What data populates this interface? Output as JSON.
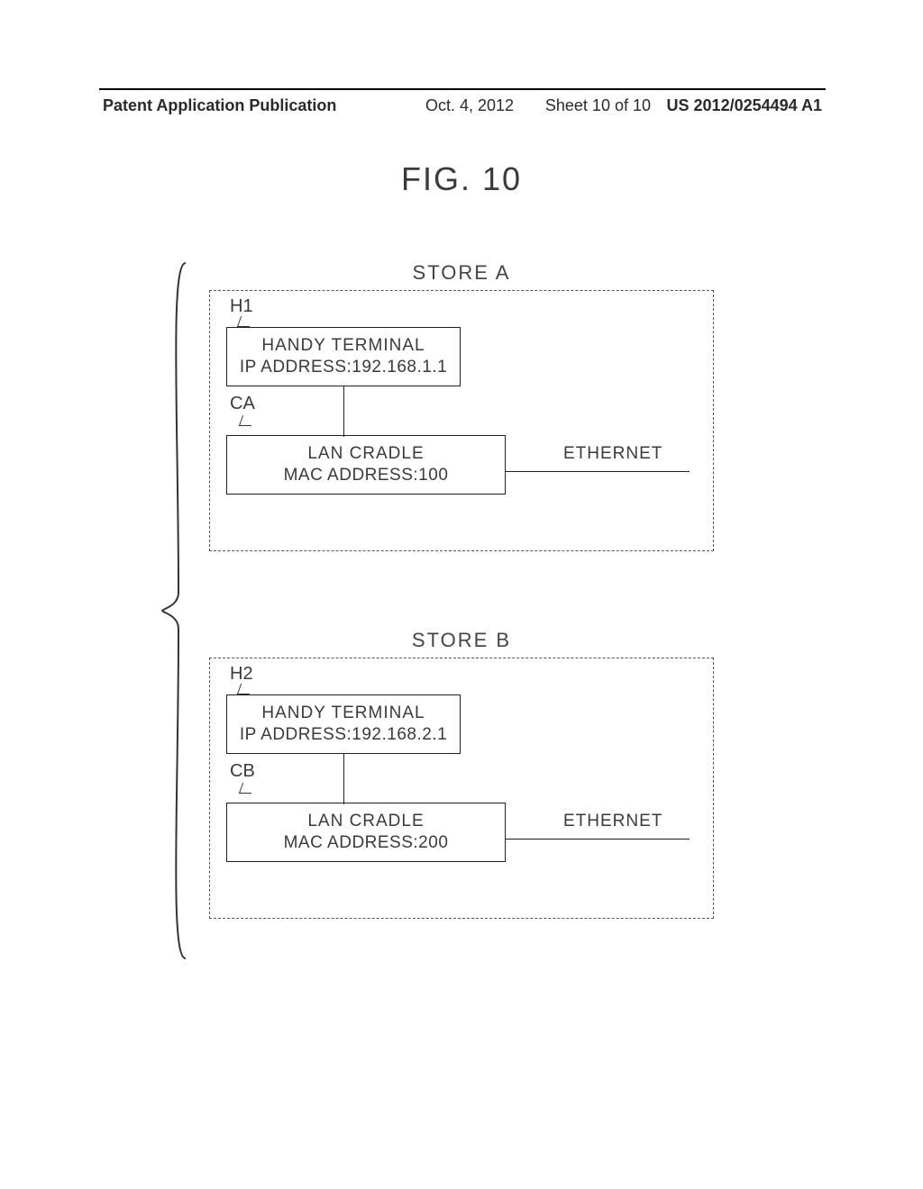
{
  "header": {
    "left": "Patent Application Publication",
    "date": "Oct. 4, 2012",
    "sheet": "Sheet 10 of 10",
    "pubno": "US 2012/0254494 A1"
  },
  "figure_title": "FIG. 10",
  "storeA": {
    "title": "STORE A",
    "terminal_ref": "H1",
    "terminal_line1": "HANDY TERMINAL",
    "terminal_line2": "IP ADDRESS:192.168.1.1",
    "cradle_ref": "CA",
    "cradle_line1": "LAN CRADLE",
    "cradle_line2": "MAC ADDRESS:100",
    "ethernet": "ETHERNET"
  },
  "storeB": {
    "title": "STORE B",
    "terminal_ref": "H2",
    "terminal_line1": "HANDY TERMINAL",
    "terminal_line2": "IP ADDRESS:192.168.2.1",
    "cradle_ref": "CB",
    "cradle_line1": "LAN CRADLE",
    "cradle_line2": "MAC ADDRESS:200",
    "ethernet": "ETHERNET"
  }
}
